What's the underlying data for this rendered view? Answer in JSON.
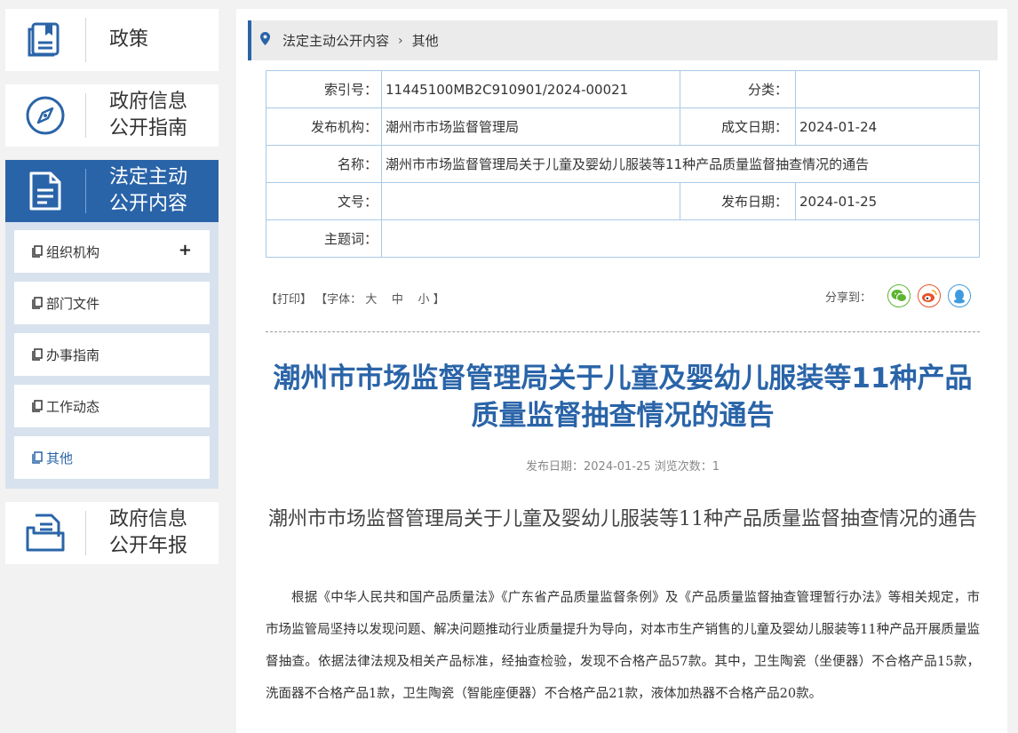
{
  "sidebar": {
    "policy": {
      "label": "政策"
    },
    "guide": {
      "line1": "政府信息",
      "line2": "公开指南"
    },
    "statutory": {
      "line1": "法定主动",
      "line2": "公开内容"
    },
    "submenu": [
      {
        "label": "组织机构",
        "expand": "+"
      },
      {
        "label": "部门文件"
      },
      {
        "label": "办事指南"
      },
      {
        "label": "工作动态"
      },
      {
        "label": "其他"
      }
    ],
    "annual": {
      "line1": "政府信息",
      "line2": "公开年报"
    }
  },
  "breadcrumb": {
    "item1": "法定主动公开内容",
    "sep": "›",
    "item2": "其他"
  },
  "meta": {
    "index_label": "索引号：",
    "index_value": "11445100MB2C910901/2024-00021",
    "category_label": "分类：",
    "category_value": "",
    "publisher_label": "发布机构：",
    "publisher_value": "潮州市市场监督管理局",
    "created_label": "成文日期：",
    "created_value": "2024-01-24",
    "name_label": "名称：",
    "name_value": "潮州市市场监督管理局关于儿童及婴幼儿服装等11种产品质量监督抽查情况的通告",
    "docno_label": "文号：",
    "docno_value": "",
    "pubdate_label": "发布日期：",
    "pubdate_value": "2024-01-25",
    "subject_label": "主题词：",
    "subject_value": ""
  },
  "toolbar": {
    "print": "【打印】",
    "font_prefix": "【字体：",
    "font_large": "大",
    "font_medium": "中",
    "font_small": "小",
    "font_suffix": "】",
    "share_label": "分享到："
  },
  "article": {
    "title": "潮州市市场监督管理局关于儿童及婴幼儿服装等11种产品质量监督抽查情况的通告",
    "pubinfo": "发布日期：2024-01-25  浏览次数：1",
    "subtitle": "潮州市市场监督管理局关于儿童及婴幼儿服装等11种产品质量监督抽查情况的通告",
    "paragraph": "根据《中华人民共和国产品质量法》《广东省产品质量监督条例》及《产品质量监督抽查管理暂行办法》等相关规定，市市场监管局坚持以发现问题、解决问题推动行业质量提升为导向，对本市生产销售的儿童及婴幼儿服装等11种产品开展质量监督抽查。依据法律法规及相关产品标准，经抽查检验，发现不合格产品57款。其中，卫生陶瓷（坐便器）不合格产品15款，洗面器不合格产品1款，卫生陶瓷（智能座便器）不合格产品21款，液体加热器不合格产品20款。"
  },
  "colors": {
    "accent": "#2a64a8",
    "wechat": "#5cb531",
    "weibo": "#e8532b",
    "qq": "#3d9be0"
  }
}
